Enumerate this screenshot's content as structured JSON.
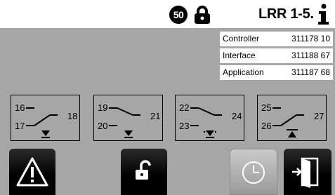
{
  "header": {
    "badge": "50",
    "device_title": "LRR 1-5."
  },
  "icons": {
    "lock": "lock-icon",
    "info": "info-icon",
    "warning": "warning-icon",
    "unlock": "unlock-icon",
    "clock": "clock-icon",
    "exit": "exit-door-icon"
  },
  "versions": [
    {
      "label": "Controller",
      "value": "311178  10"
    },
    {
      "label": "Interface",
      "value": "311188  67"
    },
    {
      "label": "Application",
      "value": "311187 68"
    }
  ],
  "relays": [
    {
      "top_left": "16",
      "bottom_left": "17",
      "right": "18"
    },
    {
      "top_left": "19",
      "bottom_left": "20",
      "right": "21"
    },
    {
      "top_left": "22",
      "bottom_left": "23",
      "right": "24"
    },
    {
      "top_left": "25",
      "bottom_left": "26",
      "right": "27"
    }
  ],
  "colors": {
    "screen_background": "#a6a6a6",
    "header_background": "#ffffff",
    "button_dark": "#000000",
    "button_light": "#b8b8b8"
  }
}
